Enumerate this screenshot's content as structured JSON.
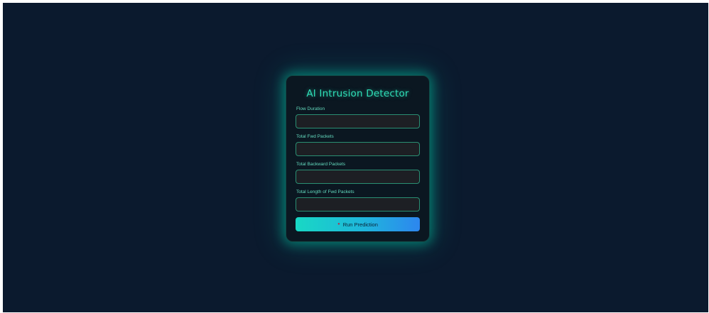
{
  "app": {
    "title": "AI Intrusion Detector"
  },
  "form": {
    "fields": [
      {
        "label": "Flow Duration",
        "value": ""
      },
      {
        "label": "Total Fwd Packets",
        "value": ""
      },
      {
        "label": "Total Backward Packets",
        "value": ""
      },
      {
        "label": "Total Length of Fwd Packets",
        "value": ""
      }
    ],
    "submit": {
      "icon": "rocket-icon",
      "label": "Run Prediction"
    }
  },
  "colors": {
    "background": "#0b1a2e",
    "card": "#0b1721",
    "accent": "#2fe0b8",
    "button_gradient_start": "#18d8c4",
    "button_gradient_end": "#2d86ef"
  }
}
